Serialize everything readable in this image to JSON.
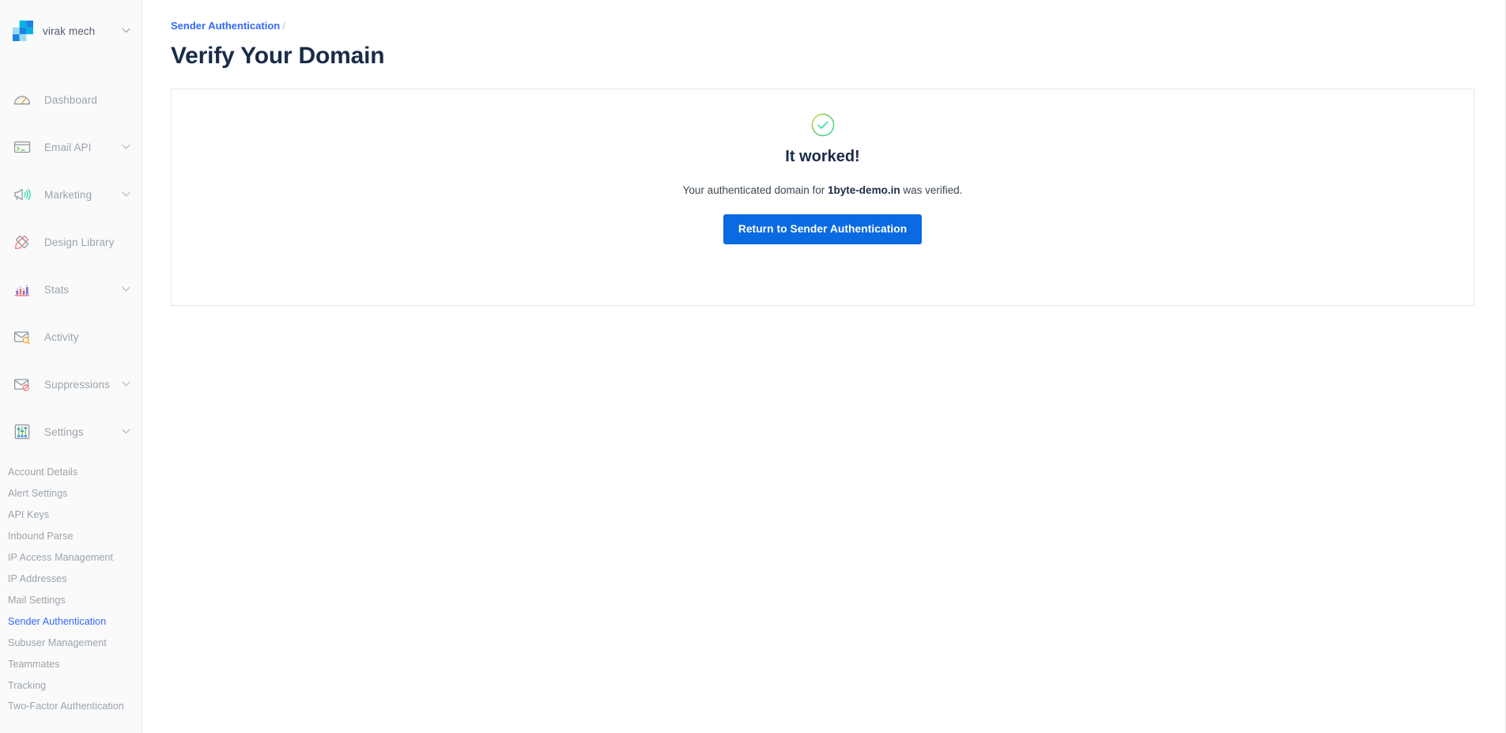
{
  "brand": {
    "name": "virak mech",
    "caret": "⌄",
    "logo_colors": [
      "#00b3e3",
      "#1a82e2",
      "#9bdcf2",
      "#1a82e2",
      "#00a5dd",
      "#9bdcf2"
    ]
  },
  "sidebar": {
    "nav": [
      {
        "label": "Dashboard",
        "icon": "gauge-icon",
        "expandable": false
      },
      {
        "label": "Email API",
        "icon": "terminal-window-icon",
        "expandable": true
      },
      {
        "label": "Marketing",
        "icon": "megaphone-icon",
        "expandable": true
      },
      {
        "label": "Design Library",
        "icon": "pencil-ruler-icon",
        "expandable": false
      },
      {
        "label": "Stats",
        "icon": "bar-chart-icon",
        "expandable": true
      },
      {
        "label": "Activity",
        "icon": "envelope-search-icon",
        "expandable": false
      },
      {
        "label": "Suppressions",
        "icon": "envelope-blocked-icon",
        "expandable": true
      },
      {
        "label": "Settings",
        "icon": "sliders-icon",
        "expandable": true
      }
    ],
    "settings_submenu": [
      {
        "label": "Account Details",
        "active": false
      },
      {
        "label": "Alert Settings",
        "active": false
      },
      {
        "label": "API Keys",
        "active": false
      },
      {
        "label": "Inbound Parse",
        "active": false
      },
      {
        "label": "IP Access Management",
        "active": false
      },
      {
        "label": "IP Addresses",
        "active": false
      },
      {
        "label": "Mail Settings",
        "active": false
      },
      {
        "label": "Sender Authentication",
        "active": true
      },
      {
        "label": "Subuser Management",
        "active": false
      },
      {
        "label": "Teammates",
        "active": false
      },
      {
        "label": "Tracking",
        "active": false
      },
      {
        "label": "Two-Factor Authentication",
        "active": false
      }
    ]
  },
  "main": {
    "breadcrumb": {
      "link": "Sender Authentication",
      "separator": "/"
    },
    "title": "Verify Your Domain",
    "card": {
      "icon": "check-circle-icon",
      "heading": "It worked!",
      "description_prefix": "Your authenticated domain for ",
      "domain": "1byte-demo.in",
      "description_suffix": " was verified.",
      "button_label": "Return to Sender Authentication"
    }
  },
  "colors": {
    "accent_blue": "#3368fa",
    "button_blue": "#0a6ae1",
    "title_navy": "#1a2b49",
    "muted_gray": "#9aa3ad",
    "success_green": "#2bd99f"
  }
}
